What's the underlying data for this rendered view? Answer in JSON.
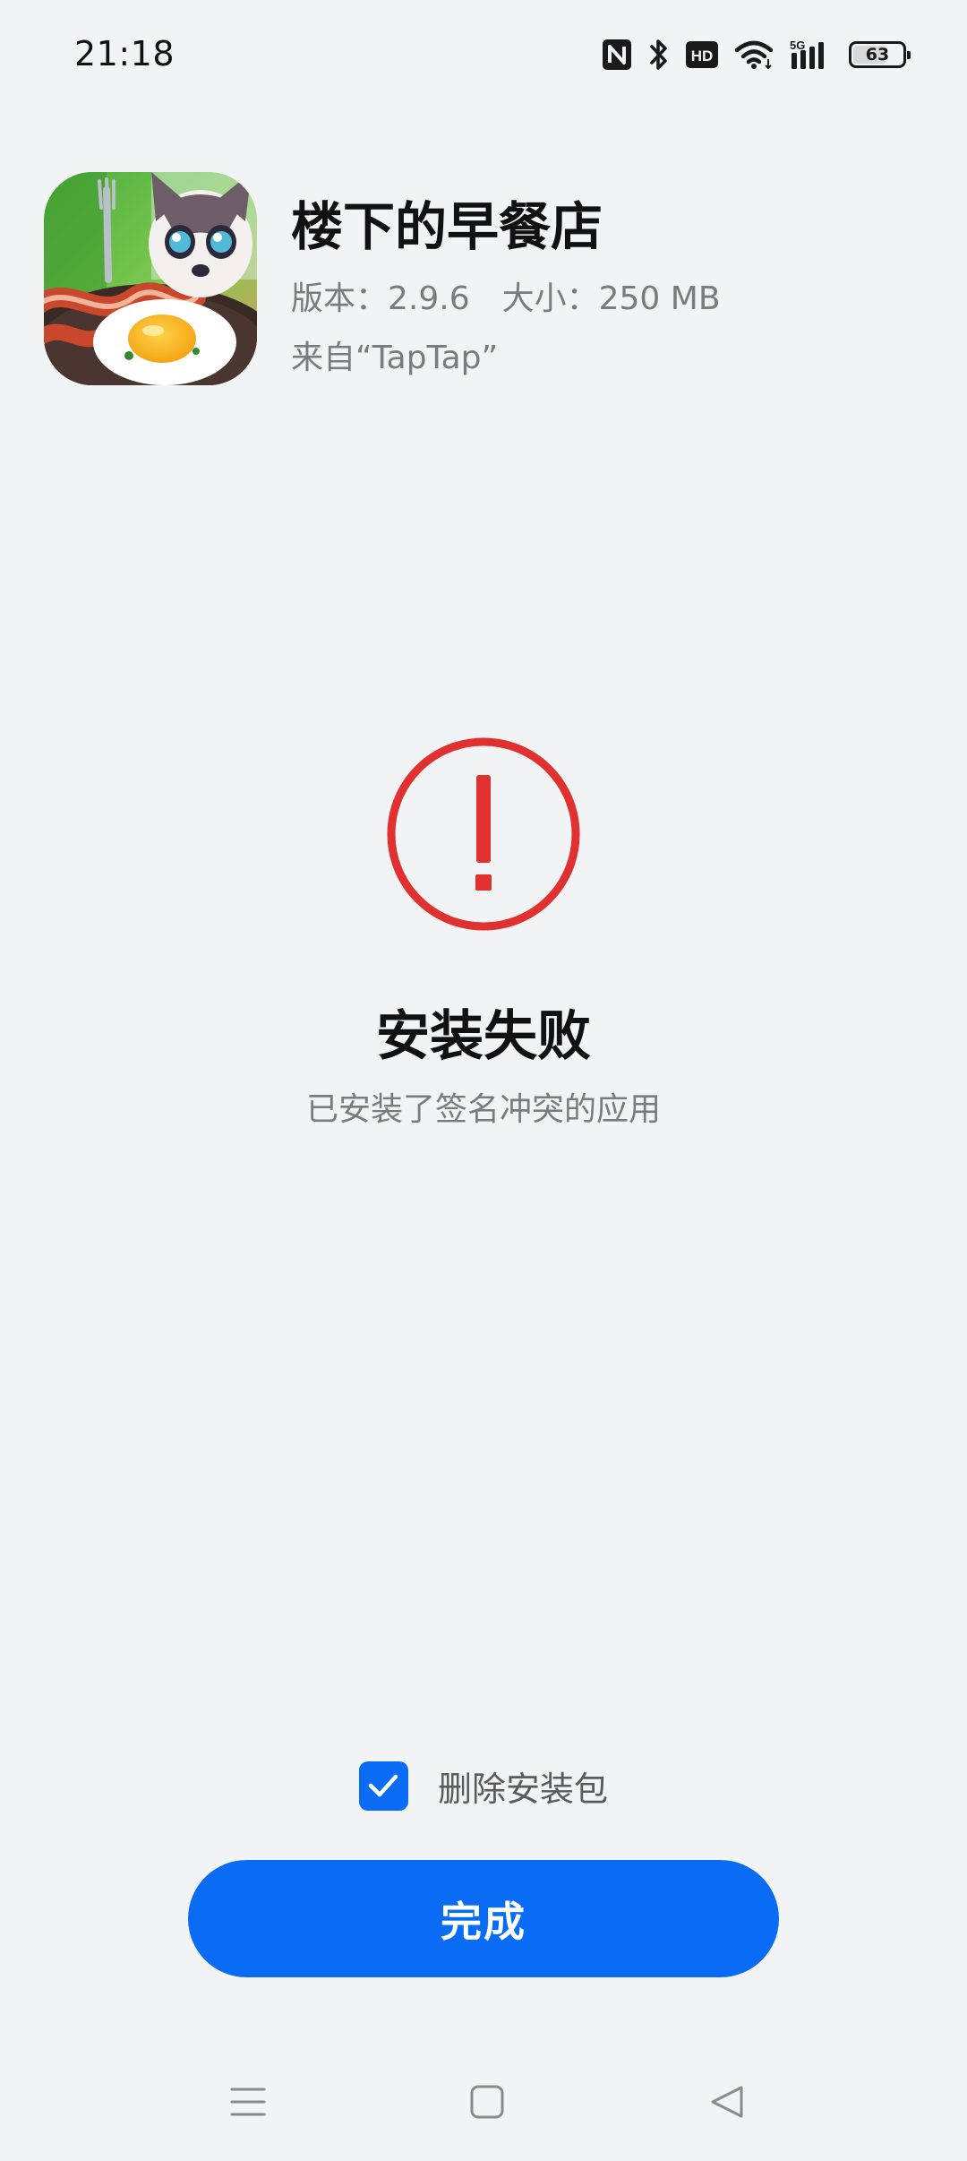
{
  "status_bar": {
    "time": "21:18",
    "icons": [
      "nfc-icon",
      "bluetooth-icon",
      "hd-icon",
      "wifi-icon",
      "5g-signal-icon",
      "battery-icon"
    ],
    "signal_type": "5G",
    "battery_level": "63"
  },
  "app": {
    "name": "楼下的早餐店",
    "version": "版本：2.9.6",
    "size": "大小：250 MB",
    "source": "来自“TapTap”"
  },
  "result": {
    "status": "error",
    "title": "安装失败",
    "message": "已安装了签名冲突的应用"
  },
  "actions": {
    "delete_package_label": "删除安装包",
    "delete_package_checked": true,
    "done_label": "完成"
  },
  "nav_bar": {
    "buttons": [
      "menu-icon",
      "home-icon",
      "back-icon"
    ]
  },
  "colors": {
    "background": "#f2f3f5",
    "accent": "#0a6cf5",
    "error": "#e03130",
    "secondary_text": "#7b7b7b"
  }
}
